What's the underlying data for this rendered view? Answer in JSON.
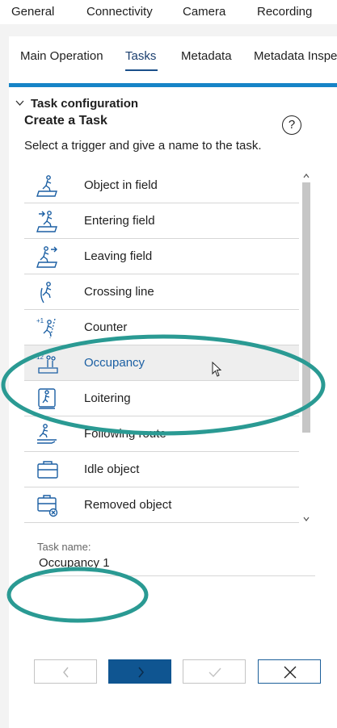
{
  "top_tabs": [
    "General",
    "Connectivity",
    "Camera",
    "Recording"
  ],
  "sub_tabs": [
    "Main Operation",
    "Tasks",
    "Metadata",
    "Metadata Inspe"
  ],
  "section": {
    "title": "Task configuration"
  },
  "create": {
    "title": "Create a Task",
    "help": "?",
    "subtitle": "Select a trigger and give a name to the task."
  },
  "tasks": [
    {
      "label": "Object in field",
      "icon": "object-in-field-icon"
    },
    {
      "label": "Entering field",
      "icon": "entering-field-icon"
    },
    {
      "label": "Leaving field",
      "icon": "leaving-field-icon"
    },
    {
      "label": "Crossing line",
      "icon": "crossing-line-icon"
    },
    {
      "label": "Counter",
      "icon": "counter-icon"
    },
    {
      "label": "Occupancy",
      "icon": "occupancy-icon",
      "selected": true
    },
    {
      "label": "Loitering",
      "icon": "loitering-icon"
    },
    {
      "label": "Following route",
      "icon": "following-route-icon"
    },
    {
      "label": "Idle object",
      "icon": "idle-object-icon"
    },
    {
      "label": "Removed object",
      "icon": "removed-object-icon"
    }
  ],
  "task_name": {
    "label": "Task name:",
    "value": "Occupancy 1"
  },
  "footer_buttons": [
    "back-button",
    "next-button",
    "finish-button",
    "close-button"
  ],
  "colors": {
    "accent": "#1784c7",
    "primary": "#0f5591",
    "selected_text": "#1b5fa3",
    "annotation": "#2a9a93"
  }
}
